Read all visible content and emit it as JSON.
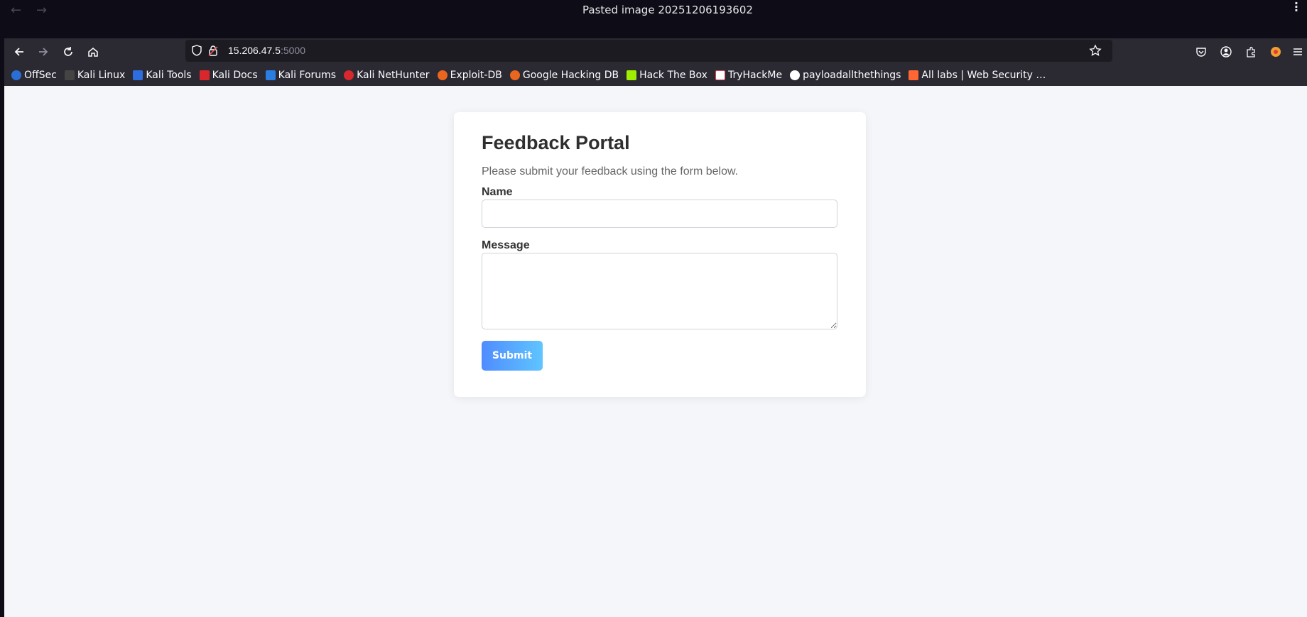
{
  "viewer": {
    "title": "Pasted image 20251206193602",
    "menu_icon": "kebab-menu-icon"
  },
  "browser": {
    "url_host": "15.206.47.5",
    "url_port": ":5000",
    "bookmarks": [
      {
        "label": "OffSec",
        "color": "#2a6fd6"
      },
      {
        "label": "Kali Linux",
        "color": "#222222"
      },
      {
        "label": "Kali Tools",
        "color": "#2d6de0"
      },
      {
        "label": "Kali Docs",
        "color": "#d8282d"
      },
      {
        "label": "Kali Forums",
        "color": "#2a7de1"
      },
      {
        "label": "Kali NetHunter",
        "color": "#d8282d"
      },
      {
        "label": "Exploit-DB",
        "color": "#e9661f"
      },
      {
        "label": "Google Hacking DB",
        "color": "#e9661f"
      },
      {
        "label": "Hack The Box",
        "color": "#9fef00"
      },
      {
        "label": "TryHackMe",
        "color": "#e04545"
      },
      {
        "label": "payloadallthethings",
        "color": "#ffffff"
      },
      {
        "label": "All labs | Web Security …",
        "color": "#ff6633"
      }
    ]
  },
  "page": {
    "title": "Feedback Portal",
    "subtitle": "Please submit your feedback using the form below.",
    "name_label": "Name",
    "message_label": "Message",
    "submit_label": "Submit"
  }
}
